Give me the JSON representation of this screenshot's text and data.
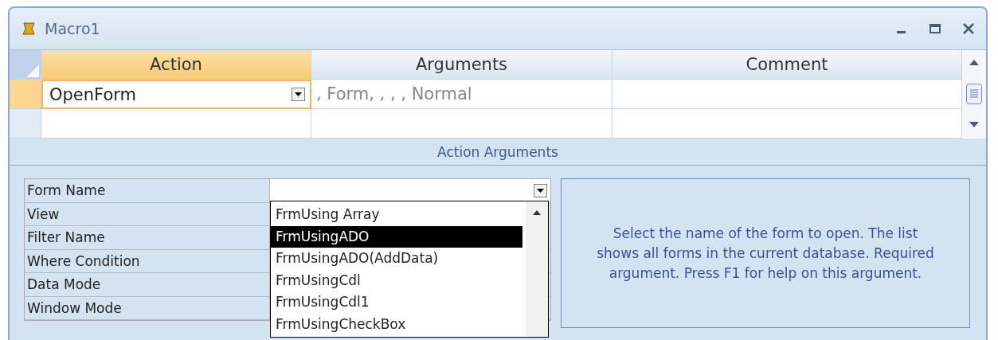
{
  "window": {
    "title": "Macro1"
  },
  "macro_grid": {
    "columns": [
      {
        "label": "Action",
        "selected": true
      },
      {
        "label": "Arguments",
        "selected": false
      },
      {
        "label": "Comment",
        "selected": false
      }
    ],
    "rows": [
      {
        "action": "OpenForm",
        "arguments": ", Form, , , , Normal",
        "selected": true
      },
      {
        "selected": false
      }
    ]
  },
  "action_arguments": {
    "title": "Action Arguments",
    "properties": [
      {
        "label": "Form Name",
        "kind": "dropdown"
      },
      {
        "label": "View",
        "kind": "text"
      },
      {
        "label": "Filter Name",
        "kind": "text"
      },
      {
        "label": "Where Condition",
        "kind": "text"
      },
      {
        "label": "Data Mode",
        "kind": "text"
      },
      {
        "label": "Window Mode",
        "kind": "text"
      }
    ],
    "dropdown": {
      "expanded": true,
      "items": [
        {
          "label": "FrmUsing Array",
          "selected": false
        },
        {
          "label": "FrmUsingADO",
          "selected": true
        },
        {
          "label": "FrmUsingADO(AddData)",
          "selected": false
        },
        {
          "label": "FrmUsingCdl",
          "selected": false
        },
        {
          "label": "FrmUsingCdl1",
          "selected": false
        },
        {
          "label": "FrmUsingCheckBox",
          "selected": false
        }
      ]
    },
    "help_text": "Select the name of the form to open. The list shows all forms in the current database. Required argument. Press F1 for help on this argument."
  }
}
